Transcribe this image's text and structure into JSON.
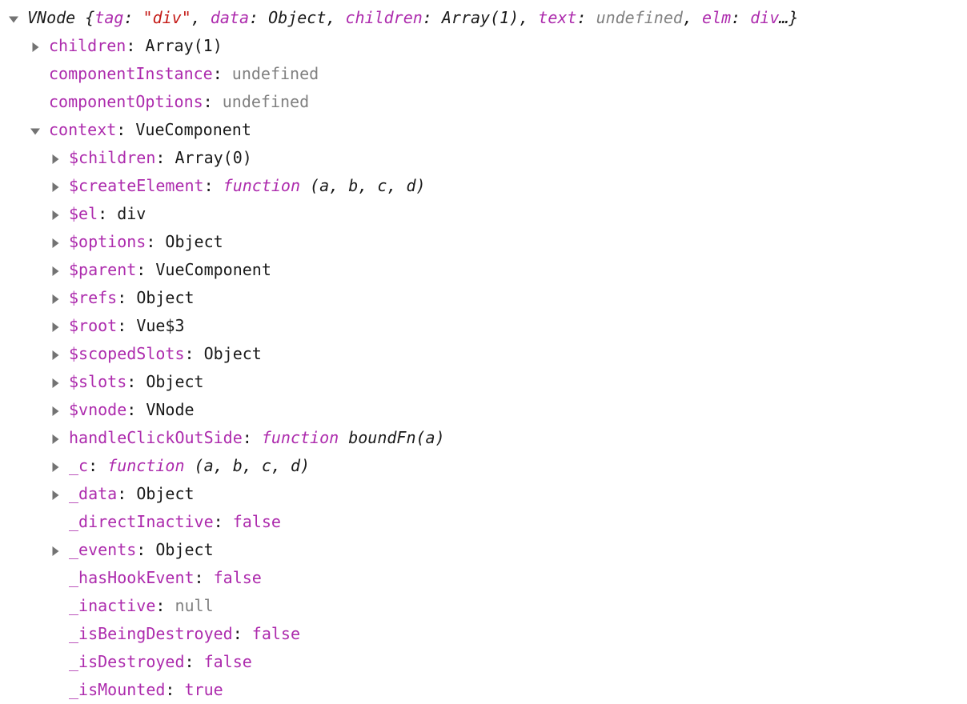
{
  "inspector": {
    "type": "devtools-object-inspector",
    "background_color": "#ffffff",
    "colors": {
      "property_name": "#ad2bad",
      "value_default": "#1a1a1a",
      "string": "#c41a16",
      "undefined": "#808080",
      "null": "#808080",
      "boolean": "#ad2bad",
      "function_keyword": "#ad2bad",
      "triangle": "#737373"
    },
    "header": {
      "constructor": "VNode",
      "open_brace": " {",
      "close_brace": "…}",
      "expanded": true,
      "preview": [
        {
          "key": "tag",
          "sep": ": ",
          "value": "\"div\"",
          "kind": "string",
          "trail": ", "
        },
        {
          "key": "data",
          "sep": ": ",
          "value": "Object",
          "kind": "object",
          "trail": ", "
        },
        {
          "key": "children",
          "sep": ": ",
          "value": "Array(1)",
          "kind": "object",
          "trail": ", "
        },
        {
          "key": "text",
          "sep": ": ",
          "value": "undefined",
          "kind": "undefined",
          "trail": ", "
        },
        {
          "key": "elm",
          "sep": ": ",
          "value": "div",
          "kind": "key",
          "trail": ""
        }
      ]
    },
    "rows": [
      {
        "level": 1,
        "marker": "collapsed",
        "name": "children",
        "value": "Array(1)",
        "kind": "object"
      },
      {
        "level": 1,
        "marker": "none",
        "name": "componentInstance",
        "value": "undefined",
        "kind": "undefined"
      },
      {
        "level": 1,
        "marker": "none",
        "name": "componentOptions",
        "value": "undefined",
        "kind": "undefined"
      },
      {
        "level": 1,
        "marker": "expanded",
        "name": "context",
        "value": "VueComponent",
        "kind": "object"
      },
      {
        "level": 2,
        "marker": "collapsed",
        "name": "$children",
        "value": "Array(0)",
        "kind": "object"
      },
      {
        "level": 2,
        "marker": "collapsed",
        "name": "$createElement",
        "value": "function",
        "kind": "function",
        "args": " (a, b, c, d)"
      },
      {
        "level": 2,
        "marker": "collapsed",
        "name": "$el",
        "value": "div",
        "kind": "object"
      },
      {
        "level": 2,
        "marker": "collapsed",
        "name": "$options",
        "value": "Object",
        "kind": "object"
      },
      {
        "level": 2,
        "marker": "collapsed",
        "name": "$parent",
        "value": "VueComponent",
        "kind": "object"
      },
      {
        "level": 2,
        "marker": "collapsed",
        "name": "$refs",
        "value": "Object",
        "kind": "object"
      },
      {
        "level": 2,
        "marker": "collapsed",
        "name": "$root",
        "value": "Vue$3",
        "kind": "object"
      },
      {
        "level": 2,
        "marker": "collapsed",
        "name": "$scopedSlots",
        "value": "Object",
        "kind": "object"
      },
      {
        "level": 2,
        "marker": "collapsed",
        "name": "$slots",
        "value": "Object",
        "kind": "object"
      },
      {
        "level": 2,
        "marker": "collapsed",
        "name": "$vnode",
        "value": "VNode",
        "kind": "object"
      },
      {
        "level": 2,
        "marker": "collapsed",
        "name": "handleClickOutSide",
        "value": "function",
        "kind": "function",
        "args": " boundFn(a)"
      },
      {
        "level": 2,
        "marker": "collapsed",
        "name": "_c",
        "value": "function",
        "kind": "function",
        "args": " (a, b, c, d)"
      },
      {
        "level": 2,
        "marker": "collapsed",
        "name": "_data",
        "value": "Object",
        "kind": "object"
      },
      {
        "level": 2,
        "marker": "none",
        "name": "_directInactive",
        "value": "false",
        "kind": "boolean"
      },
      {
        "level": 2,
        "marker": "collapsed",
        "name": "_events",
        "value": "Object",
        "kind": "object"
      },
      {
        "level": 2,
        "marker": "none",
        "name": "_hasHookEvent",
        "value": "false",
        "kind": "boolean"
      },
      {
        "level": 2,
        "marker": "none",
        "name": "_inactive",
        "value": "null",
        "kind": "null"
      },
      {
        "level": 2,
        "marker": "none",
        "name": "_isBeingDestroyed",
        "value": "false",
        "kind": "boolean"
      },
      {
        "level": 2,
        "marker": "none",
        "name": "_isDestroyed",
        "value": "false",
        "kind": "boolean"
      },
      {
        "level": 2,
        "marker": "none",
        "name": "_isMounted",
        "value": "true",
        "kind": "boolean"
      }
    ]
  }
}
